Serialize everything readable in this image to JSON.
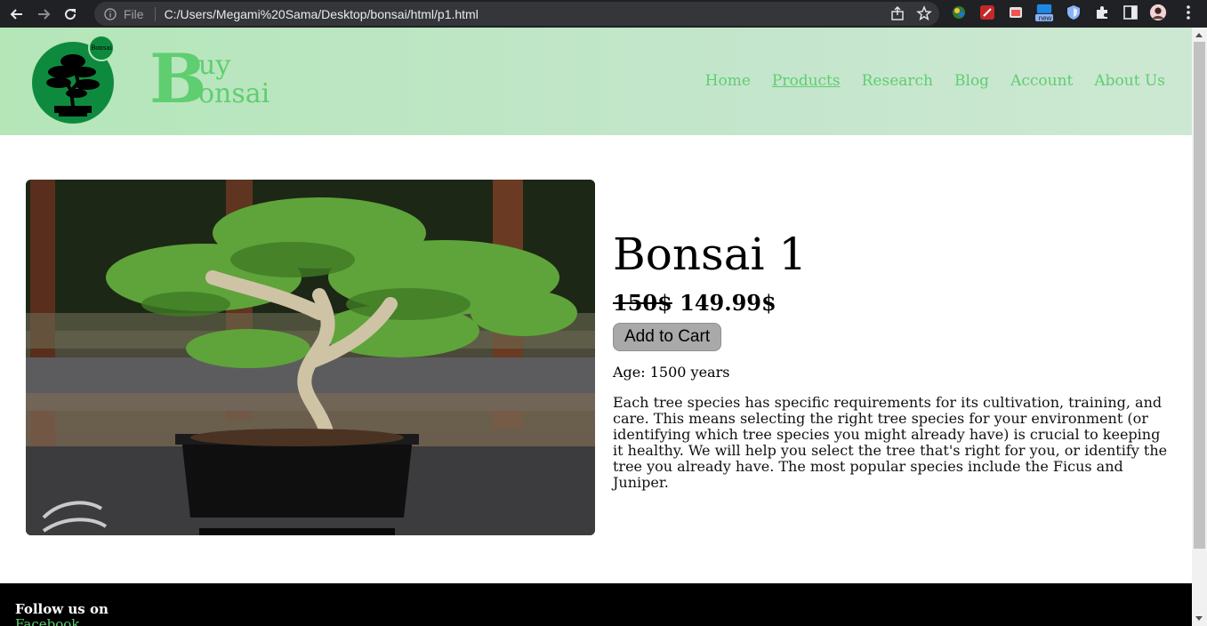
{
  "browser": {
    "scheme": "File",
    "url": "C:/Users/Megami%20Sama/Desktop/bonsai/html/p1.html",
    "ext_badge": "new"
  },
  "header": {
    "logo_text": "Bonsai",
    "brand_big": "B",
    "brand_line1": "uy",
    "brand_line2": "onsai",
    "nav": [
      "Home",
      "Products",
      "Research",
      "Blog",
      "Account",
      "About Us"
    ]
  },
  "product": {
    "title": "Bonsai 1",
    "old_price": "150$",
    "new_price": "149.99$",
    "cart_label": "Add to Cart",
    "age": "Age: 1500 years",
    "description": "Each tree species has specific requirements for its cultivation, training, and care. This means selecting the right tree species for your environment (or identifying which tree species you might already have) is crucial to keeping it healthy. We will help you select the tree that's right for you, or identify the tree you already have. The most popular species include the Ficus and Juniper."
  },
  "footer": {
    "follow": "Follow us on",
    "facebook": "Facebook"
  },
  "colors": {
    "accent": "#5fce70",
    "header_bg": "#c3e6cb",
    "logo_green": "#0e8a3e",
    "chrome_bg": "#202124",
    "button_bg": "#a9a9a9"
  }
}
